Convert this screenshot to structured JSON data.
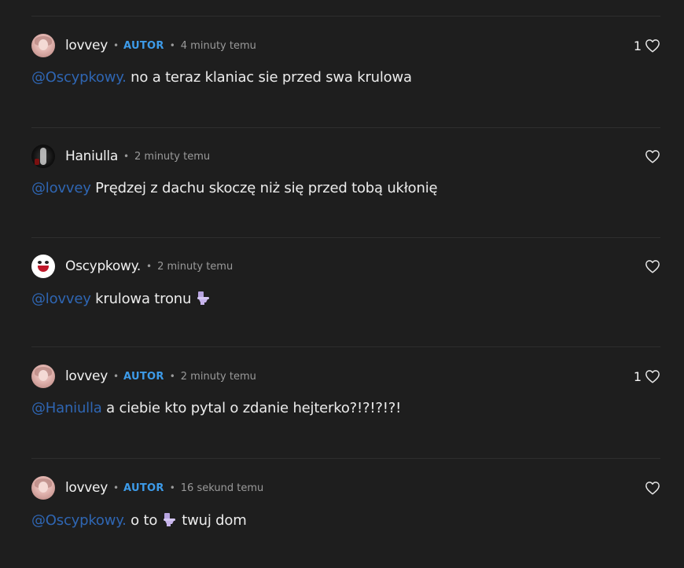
{
  "comments": [
    {
      "user": "lovvey",
      "avatar": "lovvey-avatar",
      "autor": "AUTOR",
      "time": "4 minuty temu",
      "likes": "1",
      "mention": "@Oscypkowy.",
      "text_before": " no a teraz klaniac sie przed swa krulowa",
      "emoji": "",
      "text_after": ""
    },
    {
      "user": "Haniulla",
      "avatar": "haniulla-avatar",
      "autor": "",
      "time": "2 minuty temu",
      "likes": "",
      "mention": "@lovvey",
      "text_before": " Prędzej z dachu skoczę niż się przed tobą ukłonię",
      "emoji": "",
      "text_after": ""
    },
    {
      "user": "Oscypkowy.",
      "avatar": "oscypkowy-avatar",
      "autor": "",
      "time": "2 minuty temu",
      "likes": "",
      "mention": "@lovvey",
      "text_before": " krulowa tronu ",
      "emoji": "toilet-icon",
      "text_after": ""
    },
    {
      "user": "lovvey",
      "avatar": "lovvey-avatar",
      "autor": "AUTOR",
      "time": "2 minuty temu",
      "likes": "1",
      "mention": "@Haniulla",
      "text_before": " a ciebie kto pytal o zdanie hejterko?!?!?!?!",
      "emoji": "",
      "text_after": ""
    },
    {
      "user": "lovvey",
      "avatar": "lovvey-avatar",
      "autor": "AUTOR",
      "time": "16 sekund temu",
      "likes": "",
      "mention": "@Oscypkowy.",
      "text_before": " o to ",
      "emoji": "toilet-icon",
      "text_after": " twuj dom"
    }
  ],
  "separator": "•",
  "colors": {
    "background": "#1e1e1e",
    "divider": "#2e2e2e",
    "autor": "#3d9be9",
    "mention": "#2f66b3",
    "meta": "#9a9a9a"
  },
  "icons": {
    "like": "heart-outline-icon",
    "emoji": "toilet-icon"
  }
}
